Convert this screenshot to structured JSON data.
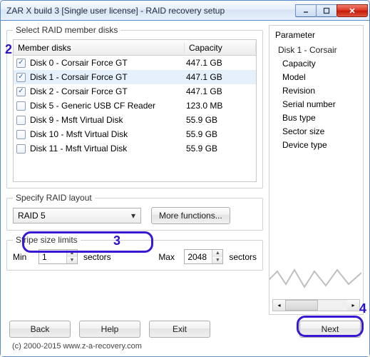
{
  "window": {
    "title": "ZAR X build 3 [Single user license] - RAID recovery setup"
  },
  "groups": {
    "select_disks": "Select RAID member disks",
    "specify_layout": "Specify RAID layout",
    "stripe_limits": "Stripe size limits",
    "parameter": "Parameter"
  },
  "columns": {
    "name": "Member disks",
    "capacity": "Capacity"
  },
  "disks": [
    {
      "name": "Disk 0 - Corsair Force GT",
      "capacity": "447.1 GB",
      "checked": true,
      "selected": false
    },
    {
      "name": "Disk 1 - Corsair Force GT",
      "capacity": "447.1 GB",
      "checked": true,
      "selected": true
    },
    {
      "name": "Disk 2 - Corsair Force GT",
      "capacity": "447.1 GB",
      "checked": true,
      "selected": false
    },
    {
      "name": "Disk 5 - Generic USB CF Reader",
      "capacity": "123.0 MB",
      "checked": false,
      "selected": false
    },
    {
      "name": "Disk 9 - Msft Virtual Disk",
      "capacity": "55.9 GB",
      "checked": false,
      "selected": false
    },
    {
      "name": "Disk 10 - Msft Virtual Disk",
      "capacity": "55.9 GB",
      "checked": false,
      "selected": false
    },
    {
      "name": "Disk 11 - Msft Virtual Disk",
      "capacity": "55.9 GB",
      "checked": false,
      "selected": false
    }
  ],
  "raid_layout": {
    "selected": "RAID 5"
  },
  "more_functions_label": "More functions...",
  "stripe": {
    "min_label": "Min",
    "max_label": "Max",
    "unit": "sectors",
    "min_value": "1",
    "max_value": "2048"
  },
  "parameters": {
    "group": "Disk 1 - Corsair",
    "items": [
      "Capacity",
      "Model",
      "Revision",
      "Serial number",
      "Bus type",
      "Sector size",
      "Device type"
    ]
  },
  "buttons": {
    "back": "Back",
    "help": "Help",
    "exit": "Exit",
    "next": "Next"
  },
  "annotations": {
    "a2": "2",
    "a3": "3",
    "a4": "4"
  },
  "copyright": "(c) 2000-2015 www.z-a-recovery.com"
}
